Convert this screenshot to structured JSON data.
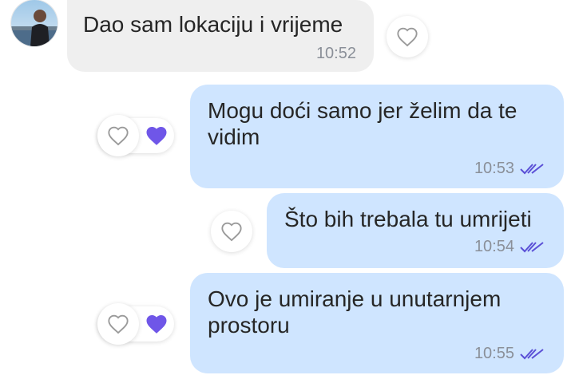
{
  "contact": {
    "avatar": "avatar-photo"
  },
  "messages": [
    {
      "direction": "incoming",
      "text": "Dao sam lokaciju i vrijeme",
      "time": "10:52",
      "reaction": "empty-heart"
    },
    {
      "direction": "outgoing",
      "text": "Mogu doći samo jer želim da te\nvidim",
      "time": "10:53",
      "status": "read-double-check",
      "reaction": "liked-purple-heart"
    },
    {
      "direction": "outgoing",
      "text": "Što bih trebala tu umrijeti",
      "time": "10:54",
      "status": "read-double-check",
      "reaction": "empty-heart"
    },
    {
      "direction": "outgoing",
      "text": "Ovo je umiranje u unutarnjem\nprostoru",
      "time": "10:55",
      "status": "read-double-check",
      "reaction": "liked-purple-heart"
    }
  ],
  "colors": {
    "incoming_bubble": "#efefef",
    "outgoing_bubble": "#cfe5ff",
    "heart_filled": "#6f56e8",
    "check": "#5a4fd6",
    "time": "#8a8f98"
  }
}
